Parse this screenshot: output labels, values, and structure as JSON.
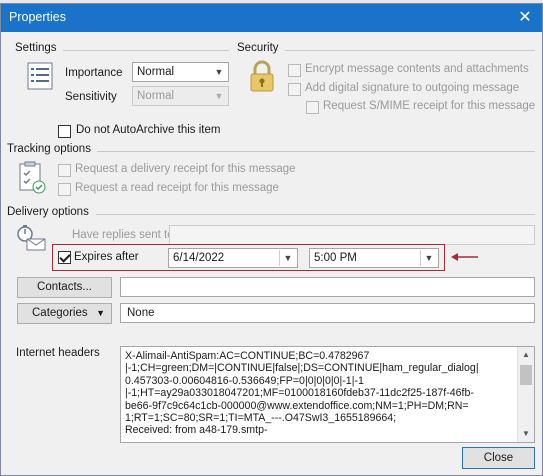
{
  "window": {
    "title": "Properties"
  },
  "settings": {
    "section_label": "Settings",
    "importance_label": "Importance",
    "importance_value": "Normal",
    "sensitivity_label": "Sensitivity",
    "sensitivity_value": "Normal",
    "autoarchive_label": "Do not AutoArchive this item"
  },
  "security": {
    "section_label": "Security",
    "encrypt_label": "Encrypt message contents and attachments",
    "signature_label": "Add digital signature to outgoing message",
    "smime_label": "Request S/MIME receipt for this message"
  },
  "tracking": {
    "section_label": "Tracking options",
    "delivery_receipt_label": "Request a delivery receipt for this message",
    "read_receipt_label": "Request a read receipt for this message"
  },
  "delivery": {
    "section_label": "Delivery options",
    "replies_label": "Have replies sent to",
    "expires_label": "Expires after",
    "expires_checked": true,
    "date_value": "6/14/2022",
    "time_value": "5:00 PM",
    "contacts_button": "Contacts...",
    "categories_button": "Categories",
    "categories_value": "None"
  },
  "internet_headers": {
    "label": "Internet headers",
    "lines": [
      "X-Alimail-AntiSpam:AC=CONTINUE;BC=0.4782967",
      "|-1;CH=green;DM=|CONTINUE|false|;DS=CONTINUE|ham_regular_dialog|",
      "0.457303-0.00604816-0.536649;FP=0|0|0|0|0|-1|-1",
      "|-1;HT=ay29a033018047201;MF=0100018160fdeb37-11dc2f25-187f-46fb-",
      "be66-9f7c9c64c1cb-000000@www.extendoffice.com;NM=1;PH=DM;RN=",
      "1;RT=1;SC=80;SR=1;TI=MTA_---.O47SwI3_1655189664;",
      "Received: from a48-179.smtp-"
    ]
  },
  "footer": {
    "close_button": "Close"
  },
  "colors": {
    "titlebar": "#1a73c8",
    "highlight_box": "#a52a3a"
  }
}
